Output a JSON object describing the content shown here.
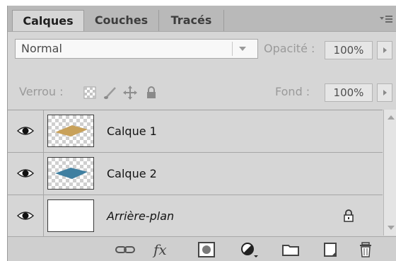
{
  "tabs": [
    {
      "label": "Calques",
      "active": true
    },
    {
      "label": "Couches",
      "active": false
    },
    {
      "label": "Tracés",
      "active": false
    }
  ],
  "panel_menu_icon": "panel-menu-icon",
  "blend": {
    "value": "Normal"
  },
  "opacity": {
    "label": "Opacité :",
    "value": "100%"
  },
  "lock": {
    "label": "Verrou :",
    "icons": [
      "lock-transparent-pixels-icon",
      "lock-image-pixels-icon",
      "lock-position-icon",
      "lock-all-icon"
    ]
  },
  "fill": {
    "label": "Fond :",
    "value": "100%"
  },
  "layers": [
    {
      "name": "Calque 1",
      "visible": true,
      "thumbnail": "transparent with tan diamond",
      "shape_color": "#c8a15a"
    },
    {
      "name": "Calque 2",
      "visible": true,
      "thumbnail": "transparent with blue diamond",
      "shape_color": "#3f7fa0"
    },
    {
      "name": "Arrière-plan",
      "visible": true,
      "locked": true,
      "thumbnail": "white"
    }
  ],
  "toolbar": {
    "icons": [
      "link-layers-icon",
      "fx-icon",
      "layer-mask-icon",
      "adjustment-layer-icon",
      "new-group-icon",
      "new-layer-icon",
      "trash-icon"
    ],
    "fx_label": "fx"
  },
  "colors": {
    "panel_bg": "#d6d6d6",
    "tab_bar_bg": "#b9b9b9",
    "text_disabled": "#9a9a9a"
  }
}
